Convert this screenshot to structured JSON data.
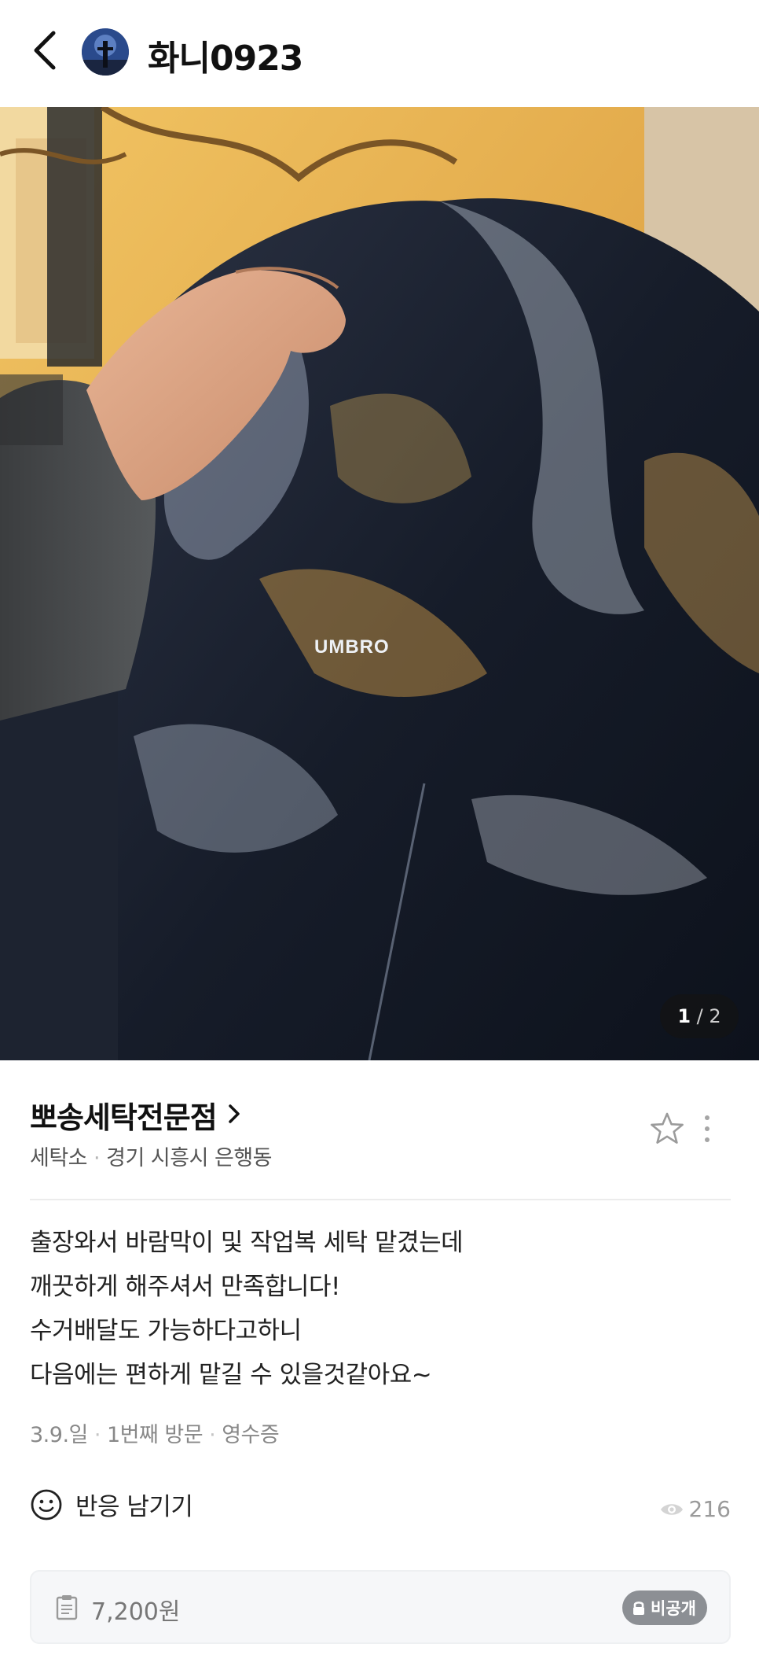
{
  "header": {
    "back_icon": "chevron-left-icon",
    "username": "화니0923"
  },
  "photo": {
    "printed_text": "UMBRO",
    "counter_current": "1",
    "counter_separator": "/",
    "counter_total": "2"
  },
  "place": {
    "name": "뽀송세탁전문점",
    "category": "세탁소",
    "location": "경기 시흥시 은행동",
    "star_icon": "star-outline-icon",
    "more_icon": "more-vertical-icon"
  },
  "review": {
    "lines": [
      "출장와서 바람막이 및 작업복 세탁 맡겼는데",
      "깨끗하게 해주셔서 만족합니다!",
      "수거배달도 가능하다고하니",
      "다음에는 편하게 맡길 수 있을것같아요~"
    ],
    "date": "3.9.일",
    "visit_count": "1번째 방문",
    "verification": "영수증"
  },
  "reaction": {
    "label": "반응 남기기",
    "icon": "smiley-icon",
    "views_icon": "eye-icon",
    "views": "216"
  },
  "receipt": {
    "icon": "receipt-icon",
    "amount": "7,200원",
    "private_label": "비공개",
    "lock_icon": "lock-icon"
  },
  "colors": {
    "text_primary": "#111111",
    "text_secondary": "#555555",
    "text_muted": "#888888",
    "badge_bg": "#8c8f94",
    "receipt_bg": "#f6f7f9"
  }
}
